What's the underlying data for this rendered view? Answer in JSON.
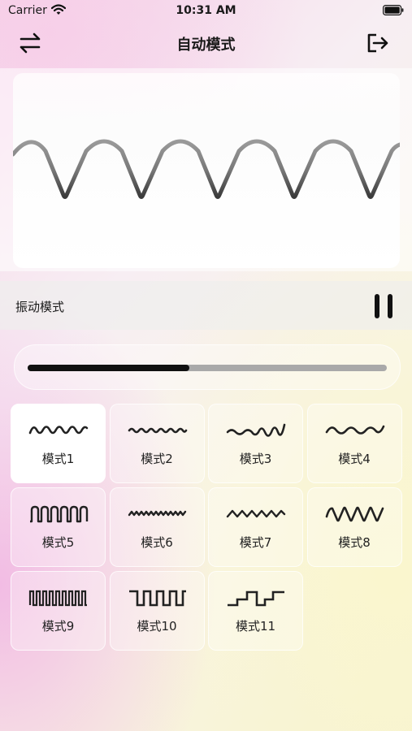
{
  "status_bar": {
    "carrier": "Carrier",
    "time": "10:31 AM"
  },
  "nav": {
    "title": "自动模式",
    "left_icon": "swap-arrows-icon",
    "right_icon": "logout-icon"
  },
  "mode_bar": {
    "label": "振动模式",
    "control_icon": "pause-icon"
  },
  "intensity": {
    "value": 0.45
  },
  "modes": [
    {
      "label": "模式1",
      "icon": "mode1-wave-icon",
      "selected": true
    },
    {
      "label": "模式2",
      "icon": "mode2-wave-icon",
      "selected": false
    },
    {
      "label": "模式3",
      "icon": "mode3-wave-icon",
      "selected": false
    },
    {
      "label": "模式4",
      "icon": "mode4-wave-icon",
      "selected": false
    },
    {
      "label": "模式5",
      "icon": "mode5-wave-icon",
      "selected": false
    },
    {
      "label": "模式6",
      "icon": "mode6-wave-icon",
      "selected": false
    },
    {
      "label": "模式7",
      "icon": "mode7-wave-icon",
      "selected": false
    },
    {
      "label": "模式8",
      "icon": "mode8-wave-icon",
      "selected": false
    },
    {
      "label": "模式9",
      "icon": "mode9-wave-icon",
      "selected": false
    },
    {
      "label": "模式10",
      "icon": "mode10-wave-icon",
      "selected": false
    },
    {
      "label": "模式11",
      "icon": "mode11-wave-icon",
      "selected": false
    }
  ],
  "colors": {
    "ink": "#111111",
    "track": "#a9a9a9",
    "selected_tile": "#ffffff"
  }
}
